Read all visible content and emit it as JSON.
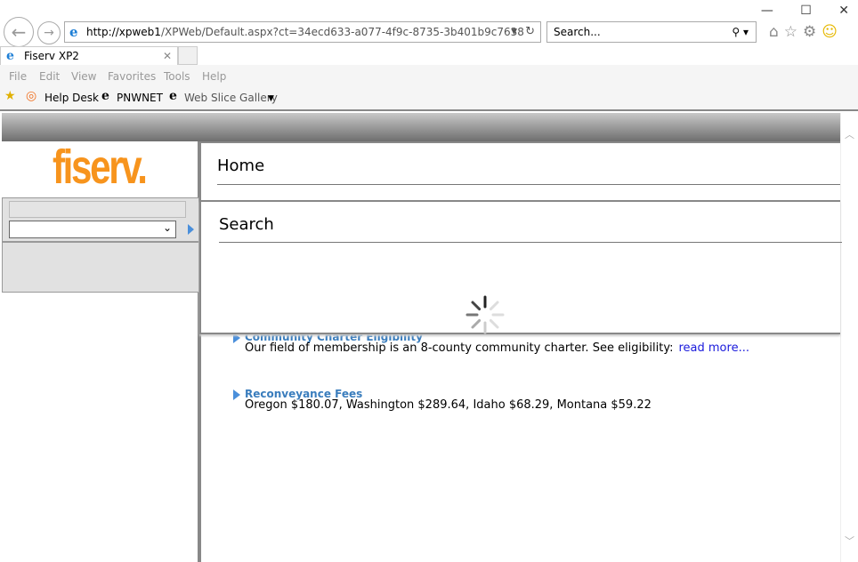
{
  "browser": {
    "url_host": "http://xpweb1",
    "url_path": "/XPWeb/Default.aspx?ct=34ecd633-a077-4f9c-8735-3b401b9c7638",
    "search_placeholder": "Search...",
    "tab_title": "Fiserv XP2",
    "menu": [
      "File",
      "Edit",
      "View",
      "Favorites",
      "Tools",
      "Help"
    ],
    "favorites": [
      "Help Desk",
      "PNWNET",
      "Web Slice Gallery"
    ]
  },
  "sidebar": {
    "logo": "fiserv."
  },
  "main": {
    "home_title": "Home",
    "search_title": "Search",
    "items": [
      {
        "title": "Community Charter Eligibility",
        "text": "Our field of membership is an 8-county community charter. See eligibility:",
        "link": "read more..."
      },
      {
        "title": "Reconveyance Fees",
        "text": "Oregon $180.07, Washington $289.64, Idaho $68.29, Montana $59.22"
      }
    ]
  }
}
